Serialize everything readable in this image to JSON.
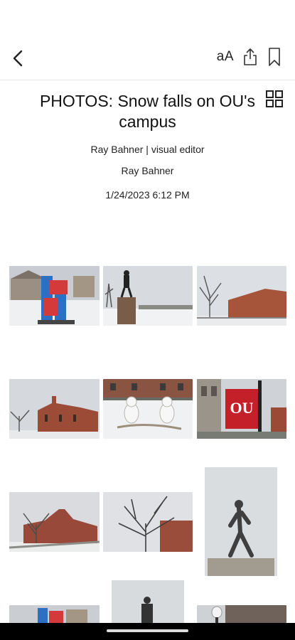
{
  "header": {
    "back_icon": "chevron-left-icon",
    "text_size_label": "aA",
    "share_icon": "share-icon",
    "bookmark_icon": "bookmark-icon"
  },
  "article": {
    "title": "PHOTOS: Snow falls on OU's campus",
    "byline": "Ray Bahner | visual editor",
    "author": "Ray Bahner",
    "date": "1/24/2023 6:12 PM",
    "grid_icon": "grid-view-icon"
  },
  "gallery": {
    "photos": [
      {
        "subject": "LOVE sculpture in snow"
      },
      {
        "subject": "Statue on pedestal"
      },
      {
        "subject": "Brick building with bare tree"
      },
      {
        "subject": "Brick gothic building"
      },
      {
        "subject": "Snowmen in front of building"
      },
      {
        "subject": "OU banner on lamp post"
      },
      {
        "subject": "Campus building with bare tree"
      },
      {
        "subject": "Bare tree and brick building"
      },
      {
        "subject": "Walking figure statue"
      },
      {
        "subject": "Statue silhouette"
      },
      {
        "subject": "LOVE sculpture partial"
      },
      {
        "subject": "Lamp post and building"
      }
    ]
  }
}
